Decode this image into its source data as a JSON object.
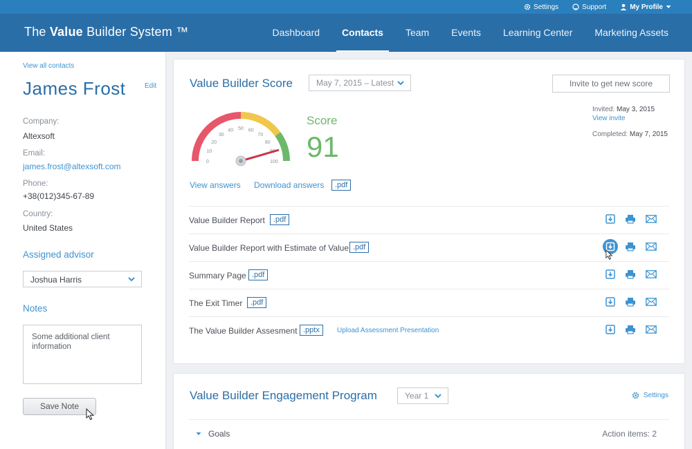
{
  "topbar": {
    "settings": "Settings",
    "support": "Support",
    "profile": "My Profile"
  },
  "header": {
    "brand_pre": "The",
    "brand_bold": "Value",
    "brand_post": "Builder System ™",
    "nav": [
      "Dashboard",
      "Contacts",
      "Team",
      "Events",
      "Learning Center",
      "Marketing Assets"
    ],
    "active_nav": "Contacts"
  },
  "sidebar": {
    "view_all": "View all contacts",
    "name": "James Frost",
    "edit": "Edit",
    "company_label": "Company:",
    "company": "Altexsoft",
    "email_label": "Email:",
    "email": "james.frost@altexsoft.com",
    "phone_label": "Phone:",
    "phone": "+38(012)345-67-89",
    "country_label": "Country:",
    "country": "United States",
    "advisor_title": "Assigned advisor",
    "advisor": "Joshua Harris",
    "notes_title": "Notes",
    "notes_text": "Some additional client information",
    "save_note": "Save Note"
  },
  "score_card": {
    "title": "Value Builder Score",
    "date_select": "May 7, 2015 – Latest",
    "invite_btn": "Invite to get new score",
    "invited_label": "Invited:",
    "invited_date": "May 3, 2015",
    "view_invite": "View invite",
    "completed_label": "Completed:",
    "completed_date": "May 7, 2015",
    "score_label": "Score",
    "score": 91,
    "gauge_ticks": [
      "0",
      "10",
      "20",
      "30",
      "40",
      "50",
      "60",
      "70",
      "80",
      "90",
      "100"
    ],
    "gauge_colors": {
      "red": "#e8566b",
      "yellow": "#f0c74c",
      "green": "#6db86b",
      "needle": "#c8354b"
    },
    "view_answers": "View answers",
    "download_answers": "Download answers",
    "answers_badge": ".pdf",
    "reports": [
      {
        "title": "Value Builder Report",
        "badge": ".pdf",
        "extra": ""
      },
      {
        "title": "Value Builder Report with Estimate of Value",
        "badge": ".pdf",
        "extra": ""
      },
      {
        "title": "Summary Page",
        "badge": ".pdf",
        "extra": ""
      },
      {
        "title": "The Exit Timer",
        "badge": ".pdf",
        "extra": ""
      },
      {
        "title": "The Value Builder Assesment",
        "badge": ".pptx",
        "extra": "Upload Assessment Presentation"
      }
    ]
  },
  "engagement_card": {
    "title": "Value Builder Engagement Program",
    "year_select": "Year 1",
    "settings": "Settings",
    "goals": "Goals",
    "action_items": "Action items: 2"
  },
  "colors": {
    "primary": "#2a6ea7",
    "link": "#3d93d0",
    "score_green": "#6db86b"
  }
}
